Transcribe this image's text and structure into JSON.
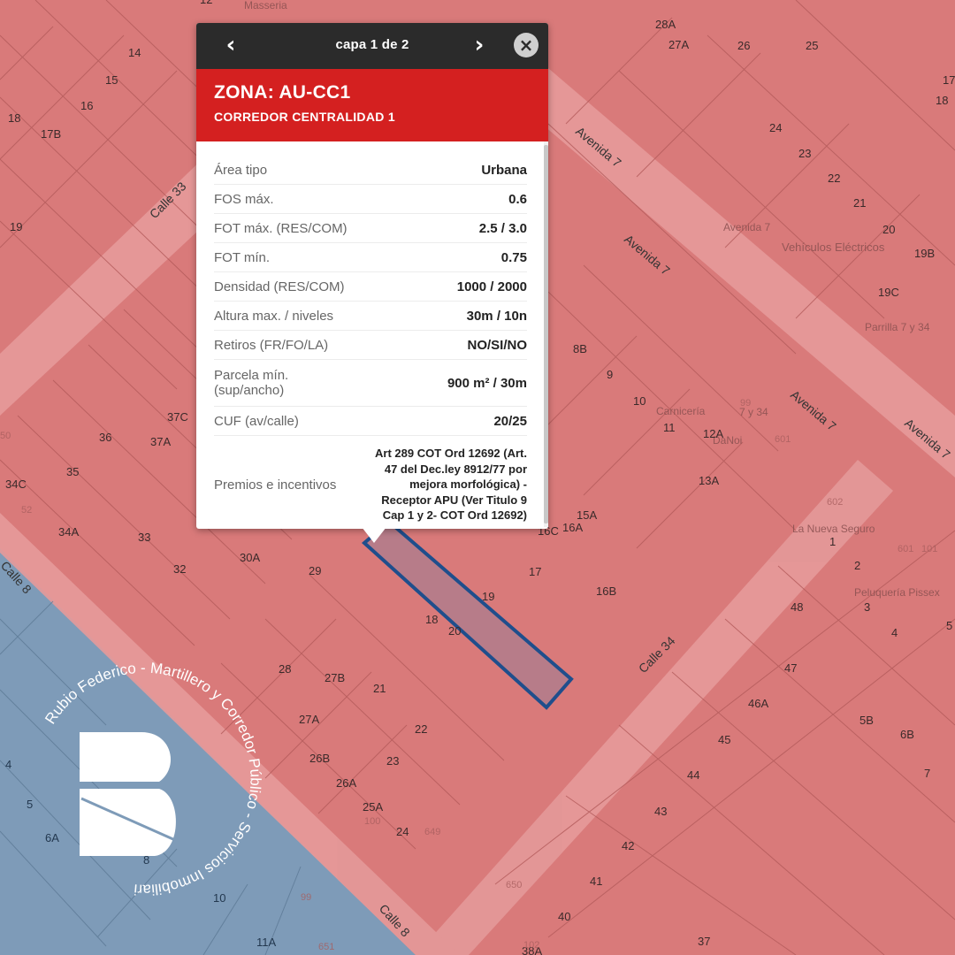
{
  "popup": {
    "nav_prev": "‹",
    "nav_next": "›",
    "layer_counter": "capa 1 de 2",
    "close": "×",
    "zone_title": "ZONA: AU-CC1",
    "zone_subtitle": "CORREDOR CENTRALIDAD 1",
    "rows": [
      {
        "label": "Área tipo",
        "value": "Urbana"
      },
      {
        "label": "FOS máx.",
        "value": "0.6"
      },
      {
        "label": "FOT máx. (RES/COM)",
        "value": "2.5 / 3.0"
      },
      {
        "label": "FOT mín.",
        "value": "0.75"
      },
      {
        "label": "Densidad (RES/COM)",
        "value": "1000 / 2000"
      },
      {
        "label": "Altura max. / niveles",
        "value": "30m / 10n"
      },
      {
        "label": "Retiros (FR/FO/LA)",
        "value": "NO/SI/NO"
      },
      {
        "label": "Parcela mín. (sup/ancho)",
        "value": "900 m² / 30m"
      },
      {
        "label": "CUF (av/calle)",
        "value": "20/25"
      },
      {
        "label": "Premios e incentivos",
        "value": "Art 289 COT Ord 12692 (Art. 47 del Dec.ley 8912/77 por mejora morfológica) - Receptor APU (Ver Titulo 9 Cap 1 y 2- COT Ord 12692)"
      }
    ]
  },
  "map": {
    "streets": [
      "Avenida 7",
      "Avenida 7",
      "Avenida 7",
      "Avenida 7",
      "Calle 33",
      "Calle 34",
      "Calle 8",
      "Calle 8"
    ],
    "places": [
      "Masseria",
      "Avenida 7",
      "Vehículos Eléctricos",
      "Parrilla 7 y 34",
      "Carnicería",
      "7 y 34",
      "DaNoi",
      "La Nueva Seguro",
      "Peluquería Pissex"
    ],
    "parcels": [
      "14",
      "15",
      "16",
      "18",
      "17B",
      "19",
      "12",
      "28A",
      "27A",
      "26",
      "25",
      "24",
      "23",
      "22",
      "21",
      "20",
      "19B",
      "19C",
      "17",
      "18",
      "8B",
      "9",
      "10",
      "11",
      "12A",
      "13A",
      "15A",
      "16A",
      "16C",
      "16B",
      "17",
      "19",
      "18",
      "20",
      "36",
      "37C",
      "37A",
      "35",
      "34C",
      "34A",
      "33",
      "32",
      "30A",
      "29",
      "28",
      "27B",
      "27A",
      "21",
      "22",
      "26B",
      "23",
      "26A",
      "25A",
      "24",
      "48",
      "47",
      "46A",
      "45",
      "44",
      "43",
      "42",
      "41",
      "40",
      "37",
      "38A",
      "2",
      "3",
      "4",
      "5",
      "5B",
      "6B",
      "7",
      "1",
      "4",
      "5",
      "6A",
      "8",
      "10",
      "11A"
    ],
    "addresses": [
      "602",
      "601",
      "99",
      "601",
      "52",
      "100",
      "649",
      "650",
      "651",
      "102",
      "99",
      "50",
      "101"
    ]
  },
  "watermark": {
    "arc_text": "Rubio Federico - Martillero y Corredor Público - Servicios Inmobiliarios"
  },
  "colors": {
    "zone_red": "#d42020",
    "map_red": "#d97a7a",
    "map_blue": "#7e9bb8",
    "selected_parcel": "#1f4e8c"
  }
}
